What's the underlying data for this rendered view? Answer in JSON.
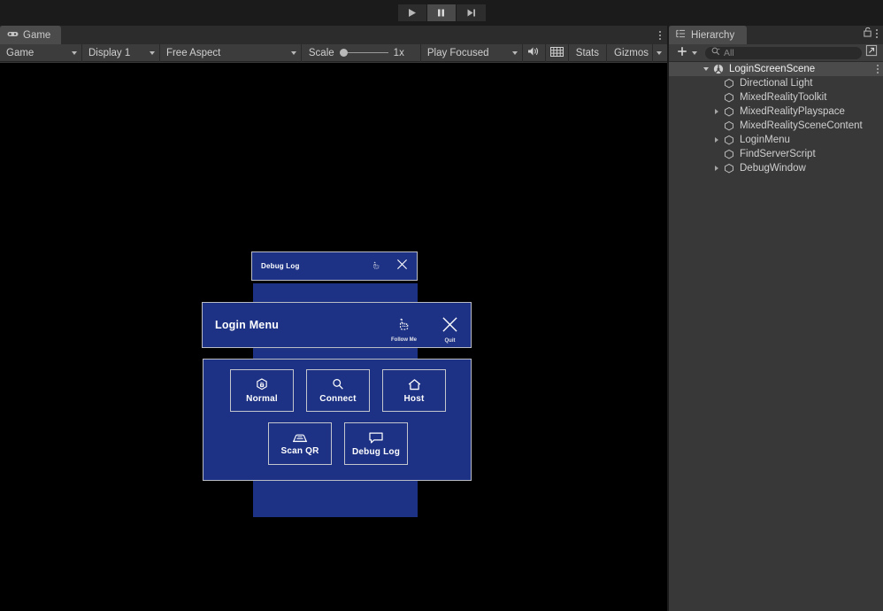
{
  "playbar": {
    "buttons": [
      {
        "name": "play",
        "label": "Play",
        "active": false
      },
      {
        "name": "pause",
        "label": "Pause",
        "active": true
      },
      {
        "name": "step",
        "label": "Step",
        "active": false
      }
    ]
  },
  "game_panel": {
    "tab_label": "Game",
    "tab_icon": "gamepad-icon",
    "toolbar": {
      "view_mode": "Game",
      "display": "Display 1",
      "aspect": "Free Aspect",
      "scale_label": "Scale",
      "scale_value": "1x",
      "play_mode": "Play Focused",
      "mute_icon": "speaker-icon",
      "resolution_icon": "grid-icon",
      "stats_label": "Stats",
      "gizmos_label": "Gizmos"
    }
  },
  "hierarchy": {
    "tab_label": "Hierarchy",
    "tab_icon": "hierarchy-icon",
    "lock_icon": "lock-icon",
    "menu_icon": "kebab-icon",
    "create_label": "+",
    "search_placeholder": "All",
    "search_value": "",
    "tree": [
      {
        "label": "LoginScreenScene",
        "depth": 0,
        "arrow": "down",
        "icon": "scene-icon",
        "selected": true,
        "kebab": true
      },
      {
        "label": "Directional Light",
        "depth": 1,
        "arrow": "none",
        "icon": "gameobject-icon",
        "selected": false,
        "kebab": false
      },
      {
        "label": "MixedRealityToolkit",
        "depth": 1,
        "arrow": "none",
        "icon": "gameobject-icon",
        "selected": false,
        "kebab": false
      },
      {
        "label": "MixedRealityPlayspace",
        "depth": 1,
        "arrow": "right",
        "icon": "gameobject-icon",
        "selected": false,
        "kebab": false
      },
      {
        "label": "MixedRealitySceneContent",
        "depth": 1,
        "arrow": "none",
        "icon": "gameobject-icon",
        "selected": false,
        "kebab": false
      },
      {
        "label": "LoginMenu",
        "depth": 1,
        "arrow": "right",
        "icon": "gameobject-icon",
        "selected": false,
        "kebab": false
      },
      {
        "label": "FindServerScript",
        "depth": 1,
        "arrow": "none",
        "icon": "gameobject-icon",
        "selected": false,
        "kebab": false
      },
      {
        "label": "DebugWindow",
        "depth": 1,
        "arrow": "right",
        "icon": "gameobject-icon",
        "selected": false,
        "kebab": false
      }
    ]
  },
  "scene_ui": {
    "colors": {
      "panel_fill": "#1d3285",
      "panel_border": "#b9bcc4",
      "text": "#ffffff",
      "background": "#000000"
    },
    "debug_log_window": {
      "title": "Debug Log",
      "follow_icon": "follow-me-icon",
      "close_icon": "close-icon"
    },
    "login_menu": {
      "title": "Login Menu",
      "follow_label": "Follow Me",
      "follow_icon": "follow-me-icon",
      "quit_label": "Quit",
      "quit_icon": "close-icon",
      "buttons_row1": [
        {
          "label": "Normal",
          "icon": "manipulation-icon"
        },
        {
          "label": "Connect",
          "icon": "search-icon"
        },
        {
          "label": "Host",
          "icon": "home-icon"
        }
      ],
      "buttons_row2": [
        {
          "label": "Scan QR",
          "icon": "scanner-icon"
        },
        {
          "label": "Debug Log",
          "icon": "speech-bubble-icon"
        }
      ]
    }
  }
}
